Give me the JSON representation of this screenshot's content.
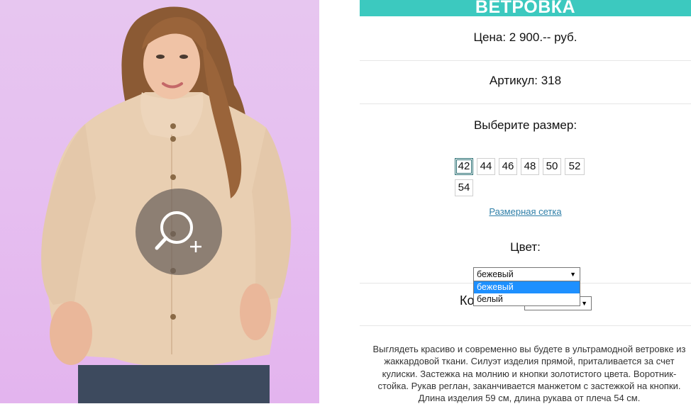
{
  "product": {
    "title": "ВЕТРОВКА",
    "price": "Цена: 2 900.-- руб.",
    "article": "Артикул: 318",
    "size_prompt": "Выберите размер:",
    "sizes": [
      "42",
      "44",
      "46",
      "48",
      "50",
      "52",
      "54"
    ],
    "selected_size": "42",
    "size_chart_link": "Размерная сетка",
    "color_label": "Цвет:",
    "color_selected": "бежевый",
    "color_options": [
      "бежевый",
      "белый"
    ],
    "quantity_label_partial": "Ко",
    "description": "Выглядеть красиво и современно вы будете в ультрамодной ветровке из жаккардовой ткани. Силуэт изделия прямой, приталивается за счет кулиски. Застежка на молнию и кнопки золотистого цвета. Воротник-стойка. Рукав реглан, заканчивается манжетом с застежкой на кнопки. Длина изделия 59 см, длина рукава от плеча 54 см."
  },
  "icons": {
    "zoom": "zoom-in-icon",
    "select_arrow": "dropdown-arrow-icon"
  },
  "colors": {
    "title_bar": "#3cc9bf",
    "link": "#2f7fa8",
    "option_highlight": "#1e90ff",
    "photo_background": "#e6bff0"
  }
}
